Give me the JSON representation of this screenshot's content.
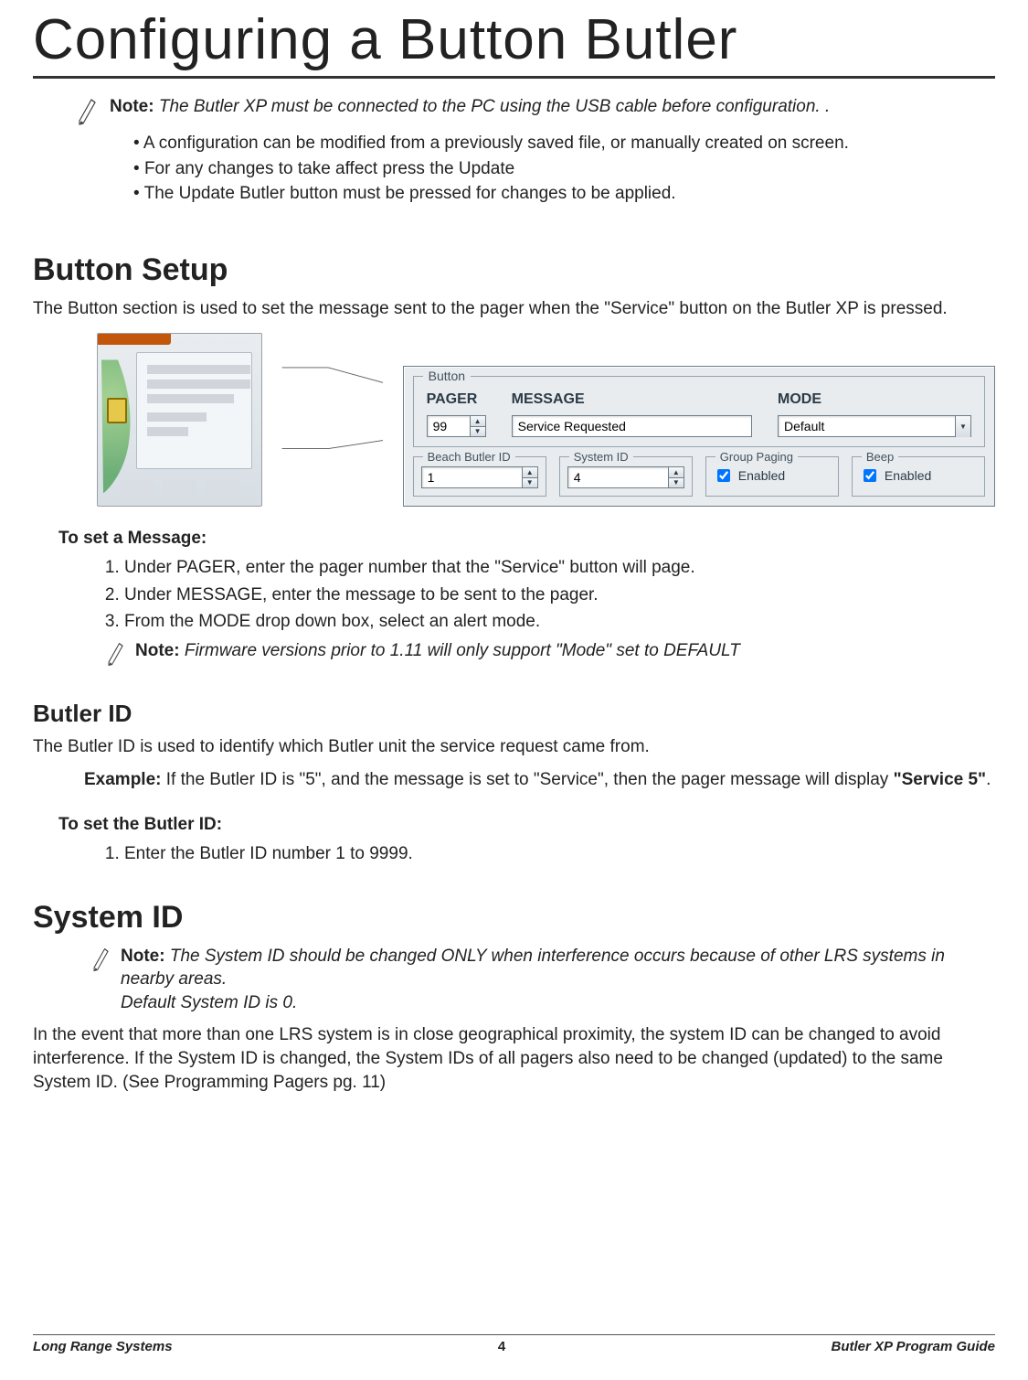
{
  "title": "Configuring a Button Butler",
  "intro_note": {
    "label": "Note:",
    "body_italic": "The Butler XP must be connected to the PC using the USB cable before configuration. .",
    "bullets": [
      "A configuration can be modified from a previously saved file, or manually created on screen.",
      "For any changes to take affect press the Update",
      "The Update Butler button must be pressed for changes to be applied."
    ]
  },
  "button_setup": {
    "heading": "Button Setup",
    "para": "The Button section is used to set the message sent to the pager when the \"Service\" button on the Butler XP is pressed."
  },
  "winpanel": {
    "fieldset_legend": "Button",
    "cols": {
      "pager": "PAGER",
      "message": "MESSAGE",
      "mode": "MODE"
    },
    "pager_value": "99",
    "message_value": "Service Requested",
    "mode_value": "Default",
    "sub_fieldsets": {
      "beach_butler_id": {
        "legend": "Beach Butler ID",
        "value": "1"
      },
      "system_id": {
        "legend": "System ID",
        "value": "4"
      },
      "group_paging": {
        "legend": "Group Paging",
        "label": "Enabled",
        "checked": true
      },
      "beep": {
        "legend": "Beep",
        "label": "Enabled",
        "checked": true
      }
    }
  },
  "set_message": {
    "heading": "To set a Message:",
    "steps": [
      "Under PAGER, enter the pager number that the \"Service\" button will page.",
      "Under MESSAGE, enter the message to be sent to the pager.",
      "From the MODE drop down box, select an alert mode."
    ],
    "inner_note_label": "Note:",
    "inner_note_body": "Firmware versions prior to 1.11 will only support \"Mode\" set to DEFAULT"
  },
  "butler_id": {
    "heading": "Butler ID",
    "para": "The Butler ID is used to identify which Butler unit the service request came from.",
    "example_label": "Example:",
    "example_body_pre": "If the Butler ID is \"5\", and the message is set to \"Service\", then the pager message will display ",
    "example_bold": "\"Service 5\"",
    "example_body_post": "."
  },
  "set_butler_id": {
    "heading": "To set the Butler ID:",
    "steps": [
      "Enter the Butler ID number 1 to 9999."
    ]
  },
  "system_id": {
    "heading": "System ID",
    "note_label": "Note:",
    "note_body_line1": "The System ID should be changed ONLY when interference occurs because of other LRS systems in nearby areas.",
    "note_body_line2": "Default System ID is 0.",
    "para": "In the event that more than one LRS system is in close geographical proximity, the system ID can be changed to avoid interference. If the System ID is changed, the System IDs of all pagers also need to be changed (updated) to the same System ID. (See Programming Pagers pg. 11)"
  },
  "footer": {
    "left": "Long Range Systems",
    "center": "4",
    "right": "Butler XP Program Guide"
  }
}
